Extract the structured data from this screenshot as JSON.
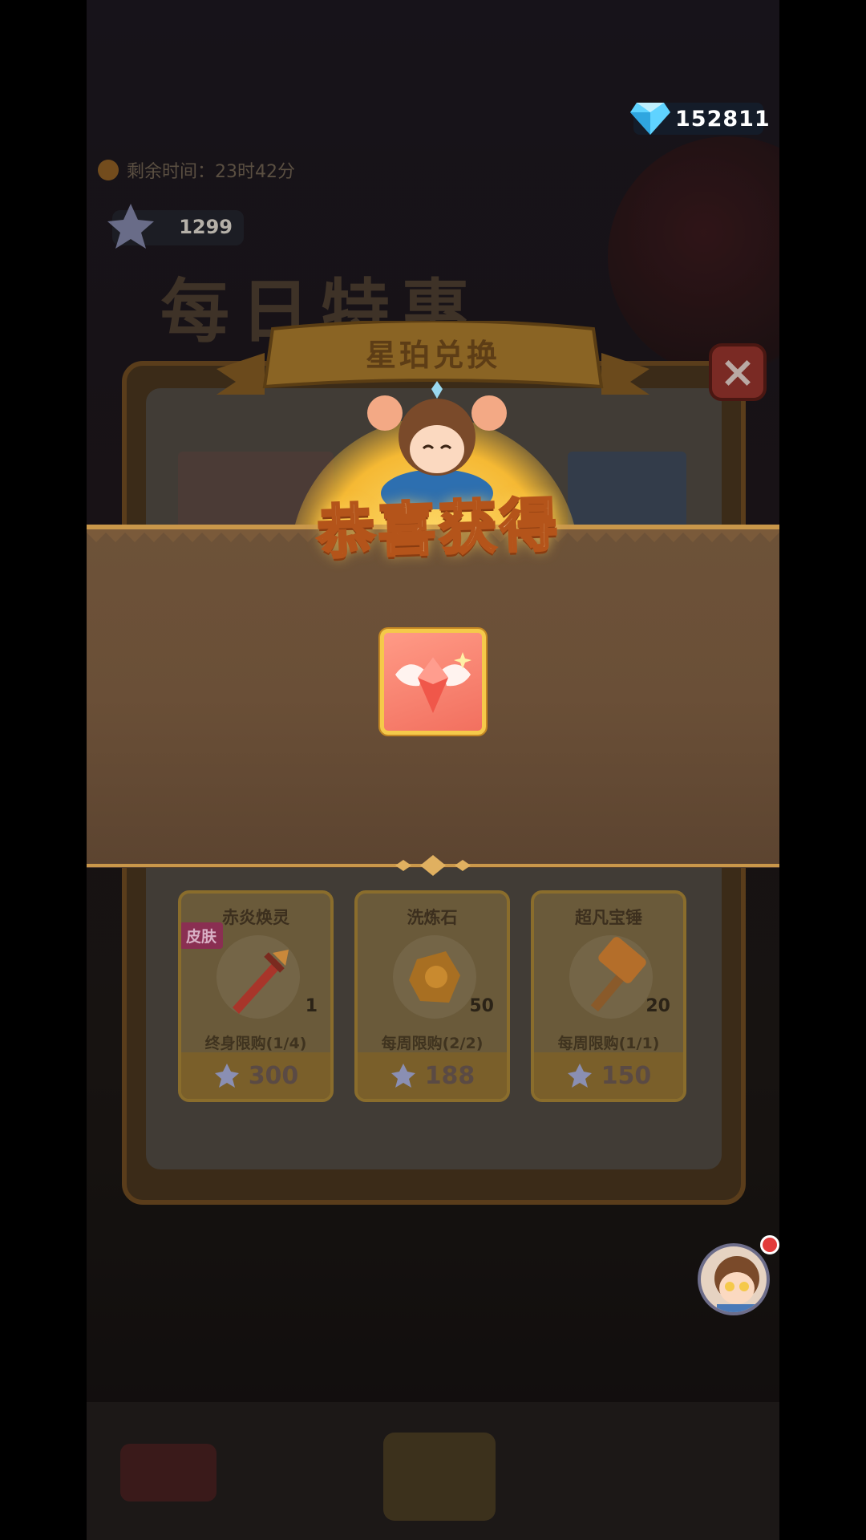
{
  "currency": {
    "gems": "152811",
    "star_amber": "1299"
  },
  "timer": {
    "label": "剩余时间：23时42分"
  },
  "page": {
    "title": "每日特惠"
  },
  "dialog": {
    "title": "星珀兑换",
    "congrats": "恭喜获得",
    "reward_icon": "wing-gem-icon"
  },
  "products": [
    {
      "name": "赤炎焕灵",
      "badge": "皮肤",
      "qty": "1",
      "limit": "终身限购(1/4)",
      "price": "300",
      "icon": "sword-icon"
    },
    {
      "name": "洗炼石",
      "badge": "",
      "qty": "50",
      "limit": "每周限购(2/2)",
      "price": "188",
      "icon": "stone-icon"
    },
    {
      "name": "超凡宝锤",
      "badge": "",
      "qty": "20",
      "limit": "每周限购(1/1)",
      "price": "150",
      "icon": "hammer-icon"
    }
  ],
  "colors": {
    "accent_gold": "#f5c94a",
    "banner_brown": "#6a4f37",
    "close_red": "#7a2a24"
  }
}
